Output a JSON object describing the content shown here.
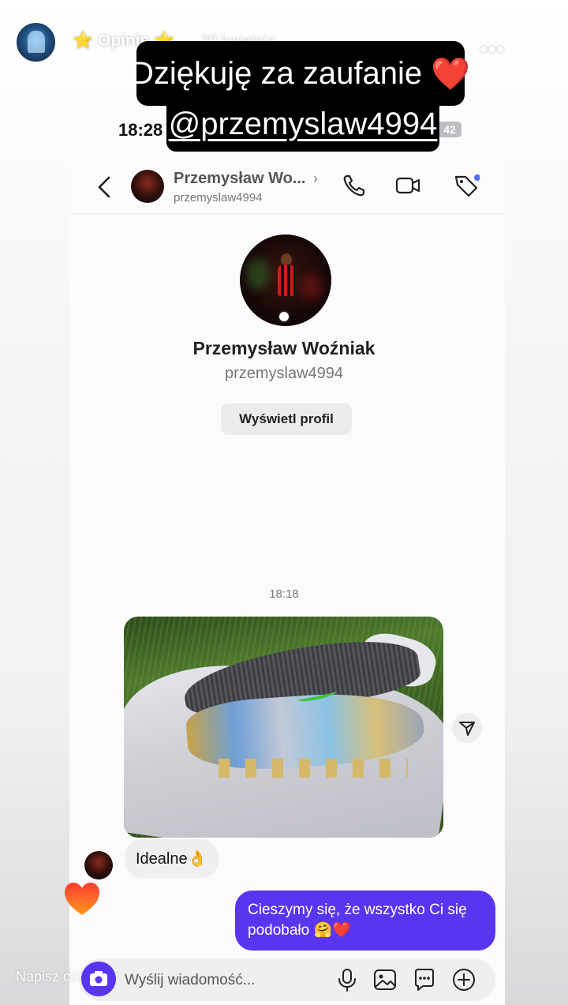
{
  "story": {
    "title": "⭐ Opinie ⭐",
    "date": "30 kwietnia",
    "more_label": "•••",
    "progress": 1.0,
    "overlay_line1": "Dziękuję za zaufanie",
    "overlay_heart": "❤️",
    "overlay_line2": "@przemyslaw4994",
    "status_time": "18:28",
    "status_battery": "42",
    "reply_placeholder": "Napisz co..."
  },
  "dm_header": {
    "name": "Przemysław Wo...",
    "chevron": "›",
    "username": "przemyslaw4994",
    "icons": [
      "back-arrow-icon",
      "phone-icon",
      "video-icon",
      "tag-icon"
    ]
  },
  "profile": {
    "name": "Przemysław Woźniak",
    "username": "przemyslaw4994",
    "button_label": "Wyświetl profil"
  },
  "chat": {
    "timestamp": "18:18",
    "incoming_text": "Idealne👌",
    "reaction": "❤️",
    "outgoing_text": "Cieszymy się, że wszystko Ci się podobało 🤗❤️"
  },
  "composer": {
    "placeholder": "Wyślij wiadomość...",
    "icons": [
      "camera-icon",
      "microphone-icon",
      "gallery-icon",
      "sticker-icon",
      "plus-icon"
    ]
  },
  "colors": {
    "accent": "#5a35f0",
    "overlay_bg": "#000000",
    "bubble_in": "#efeff1",
    "notification_dot": "#4a6cf7"
  }
}
